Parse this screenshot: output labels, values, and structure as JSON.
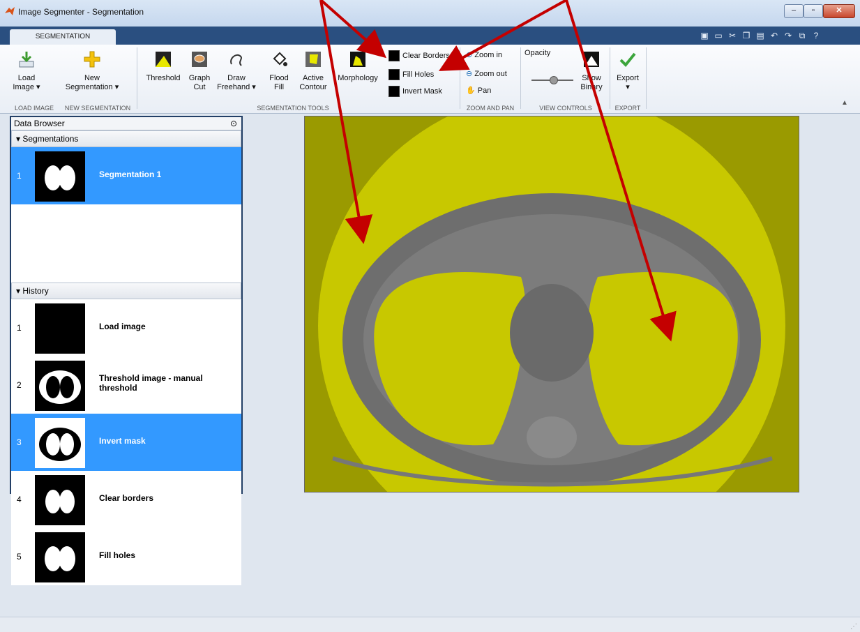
{
  "window": {
    "title": "Image Segmenter - Segmentation"
  },
  "tabs": {
    "active": "SEGMENTATION"
  },
  "ribbon": {
    "load_image": "Load\nImage ▾",
    "new_segmentation": "New\nSegmentation ▾",
    "threshold": "Threshold",
    "graph_cut": "Graph\nCut",
    "draw_freehand": "Draw\nFreehand ▾",
    "flood_fill": "Flood\nFill",
    "active_contour": "Active\nContour",
    "morphology": "Morphology",
    "clear_borders": "Clear Borders",
    "fill_holes": "Fill Holes",
    "invert_mask": "Invert Mask",
    "zoom_in": "Zoom in",
    "zoom_out": "Zoom out",
    "pan": "Pan",
    "opacity": "Opacity",
    "show_binary": "Show\nBinary",
    "export": "Export",
    "groups": [
      "LOAD IMAGE",
      "NEW SEGMENTATION",
      "SEGMENTATION TOOLS",
      "ZOOM AND PAN",
      "VIEW CONTROLS",
      "EXPORT"
    ]
  },
  "data_browser": {
    "title": "Data Browser",
    "segmentations_header": "Segmentations",
    "segmentations": [
      {
        "num": "1",
        "label": "Segmentation 1"
      }
    ],
    "history_header": "History",
    "history": [
      {
        "num": "1",
        "label": "Load image"
      },
      {
        "num": "2",
        "label": "Threshold image - manual threshold"
      },
      {
        "num": "3",
        "label": "Invert mask"
      },
      {
        "num": "4",
        "label": "Clear borders"
      },
      {
        "num": "5",
        "label": "Fill holes"
      }
    ]
  },
  "colors": {
    "mask_overlay": "#c8c800",
    "selection": "#3399ff",
    "annotation_arrow": "#c40000"
  }
}
